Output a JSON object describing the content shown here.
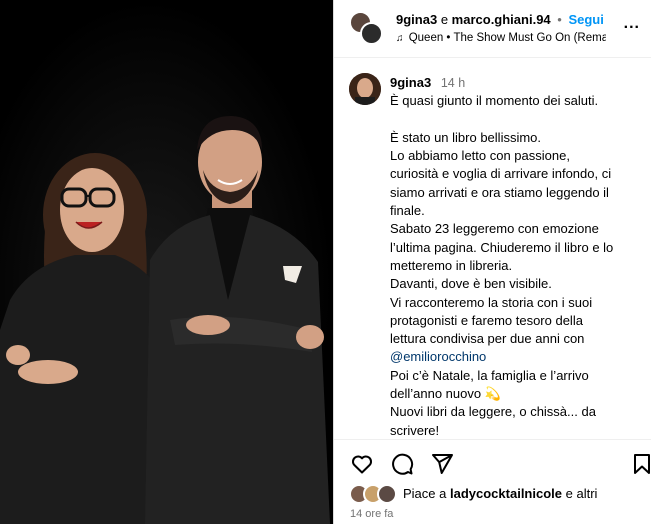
{
  "header": {
    "user1": "9gina3",
    "conjunction": "e",
    "user2": "marco.ghiani.94",
    "separator": "•",
    "follow_label": "Segui",
    "audio_icon": "music-note-icon",
    "audio_label": "Queen • The Show Must Go On (Remast...",
    "more_icon": "more-horizontal-icon",
    "more_label": "..."
  },
  "caption": {
    "username": "9gina3",
    "time": "14 h",
    "lines": [
      "È quasi giunto il momento dei saluti.",
      "",
      "È stato un libro bellissimo.",
      "Lo abbiamo letto con passione,",
      "curiosità e voglia di arrivare infondo, ci",
      "siamo arrivati e ora stiamo leggendo il",
      "finale.",
      "Sabato 23 leggeremo con emozione",
      "l’ultima pagina. Chiuderemo il libro e lo",
      "metteremo in libreria.",
      "Davanti, dove è ben visibile.",
      "Vi racconteremo la storia con i suoi",
      "protagonisti e faremo tesoro della",
      "lettura condivisa per due anni con"
    ],
    "mention": "@emiliorocchino",
    "lines_after": [
      "Poi c’è Natale, la famiglia e l’arrivo",
      "dell’anno nuovo 💫",
      "Nuovi libri da leggere, o chissà... da",
      "scrivere!"
    ]
  },
  "actions": {
    "like_icon": "heart-icon",
    "comment_icon": "comment-icon",
    "share_icon": "send-icon",
    "save_icon": "bookmark-icon"
  },
  "likes": {
    "prefix": "Piace a",
    "user": "ladycocktailnicole",
    "suffix": "e altri"
  },
  "timestamp": "14 ore fa",
  "colors": {
    "link_blue": "#0095f6",
    "mention_blue": "#00376b",
    "muted": "#737373"
  }
}
